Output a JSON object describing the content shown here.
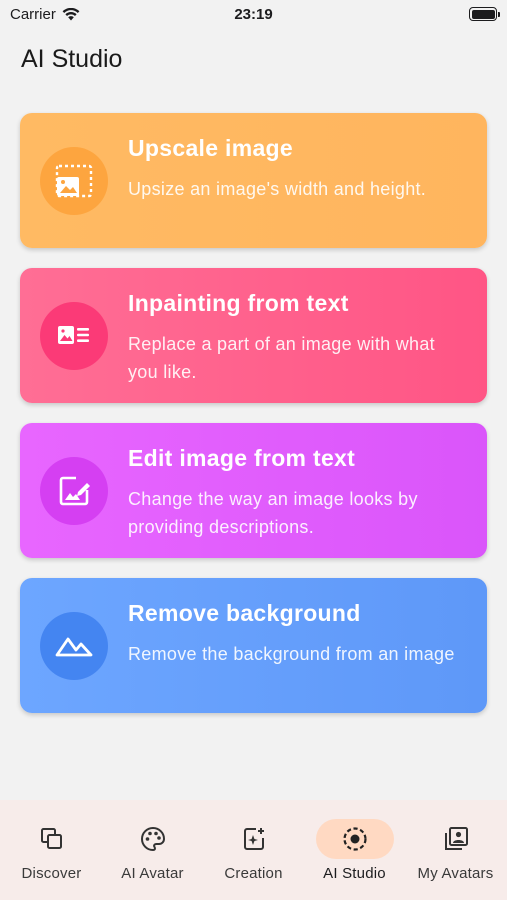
{
  "status_bar": {
    "carrier": "Carrier",
    "time": "23:19"
  },
  "page": {
    "title": "AI Studio"
  },
  "cards": [
    {
      "title": "Upscale image",
      "description": "Upsize an image's width and height.",
      "icon": "upscale-image-icon",
      "color": "#ffb55e"
    },
    {
      "title": "Inpainting from text",
      "description": "Replace a part of an image with what you like.",
      "icon": "image-text-icon",
      "color": "#ff5585"
    },
    {
      "title": "Edit image from text",
      "description": "Change the way an image looks by providing descriptions.",
      "icon": "edit-image-icon",
      "color": "#da55fa"
    },
    {
      "title": "Remove background",
      "description": "Remove the background from an image",
      "icon": "mountains-icon",
      "color": "#5e98f8"
    }
  ],
  "tabs": [
    {
      "label": "Discover",
      "icon": "copy-icon",
      "active": false
    },
    {
      "label": "AI Avatar",
      "icon": "palette-icon",
      "active": false
    },
    {
      "label": "Creation",
      "icon": "sparkle-add-icon",
      "active": false
    },
    {
      "label": "AI Studio",
      "icon": "target-icon",
      "active": true
    },
    {
      "label": "My Avatars",
      "icon": "portrait-library-icon",
      "active": false
    }
  ],
  "colors": {
    "background": "#f2f2f2",
    "tabbar": "#f7ecea",
    "active_tab": "#ffd9c2"
  }
}
